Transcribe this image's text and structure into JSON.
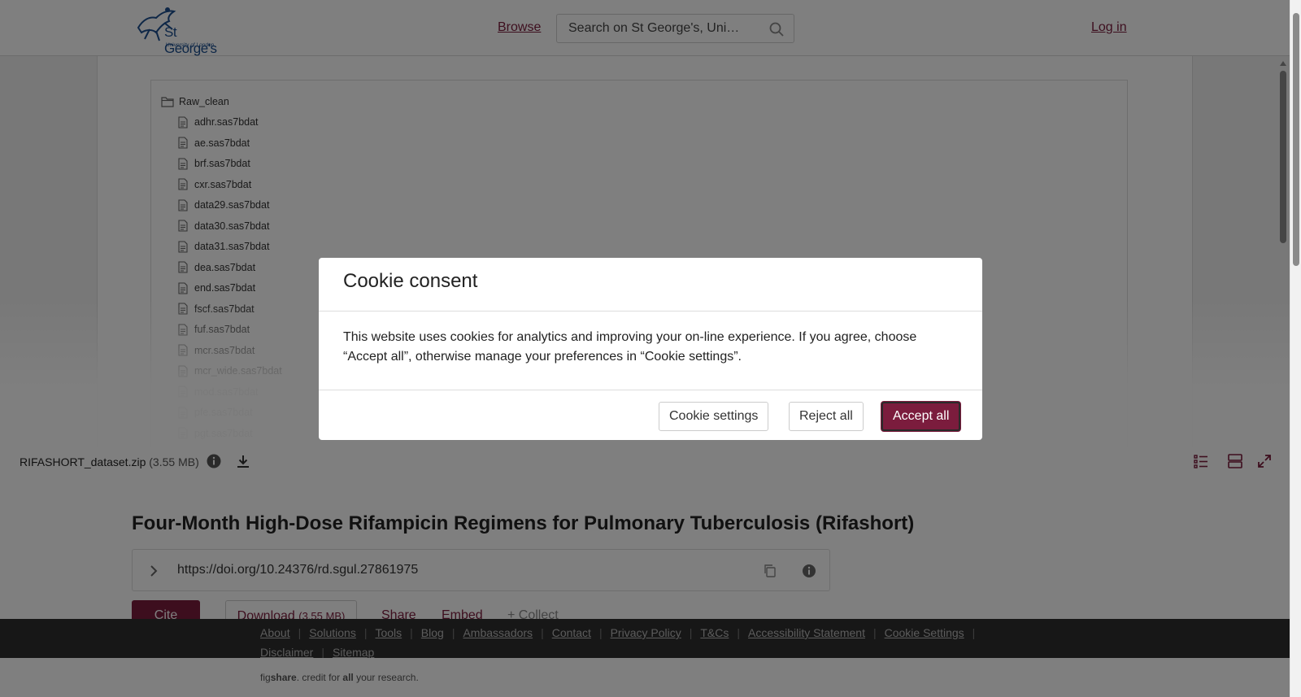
{
  "header": {
    "logo_name": "St George's",
    "logo_sub": "University of London",
    "browse": "Browse",
    "search_placeholder": "Search on St George's, Uni…",
    "login": "Log in"
  },
  "viewer": {
    "folder": "Raw_clean",
    "files": [
      "adhr.sas7bdat",
      "ae.sas7bdat",
      "brf.sas7bdat",
      "cxr.sas7bdat",
      "data29.sas7bdat",
      "data30.sas7bdat",
      "data31.sas7bdat",
      "dea.sas7bdat",
      "end.sas7bdat",
      "fscf.sas7bdat",
      "fuf.sas7bdat",
      "mcr.sas7bdat",
      "mcr_wide.sas7bdat",
      "mod.sas7bdat",
      "pfe.sas7bdat",
      "pgt.sas7bdat"
    ],
    "file_name": "RIFASHORT_dataset.zip",
    "file_size": "(3.55 MB)"
  },
  "article": {
    "title": "Four-Month High-Dose Rifampicin Regimens for Pulmonary Tuberculosis (Rifashort)",
    "doi": "https://doi.org/10.24376/rd.sgul.27861975",
    "cite": "Cite",
    "download": "Download",
    "download_size": "(3.55 MB)",
    "share": "Share",
    "embed": "Embed",
    "collect": "+ Collect"
  },
  "footer": {
    "links": [
      "About",
      "Solutions",
      "Tools",
      "Blog",
      "Ambassadors",
      "Contact",
      "Privacy Policy",
      "T&Cs",
      "Accessibility Statement",
      "Cookie Settings",
      "Disclaimer",
      "Sitemap"
    ],
    "tagline_pre": "fig",
    "tagline_brand": "share",
    "tagline_mid": ". credit for ",
    "tagline_all": "all",
    "tagline_post": " your research."
  },
  "modal": {
    "title": "Cookie consent",
    "body": "This website uses cookies for analytics and improving your on-line experience. If you agree, choose “Accept all”, otherwise manage your preferences in “Cookie settings”.",
    "settings": "Cookie settings",
    "reject": "Reject all",
    "accept": "Accept all"
  },
  "colors": {
    "brand": "#7b1c3d",
    "footer_bg": "#2f2f2f"
  }
}
